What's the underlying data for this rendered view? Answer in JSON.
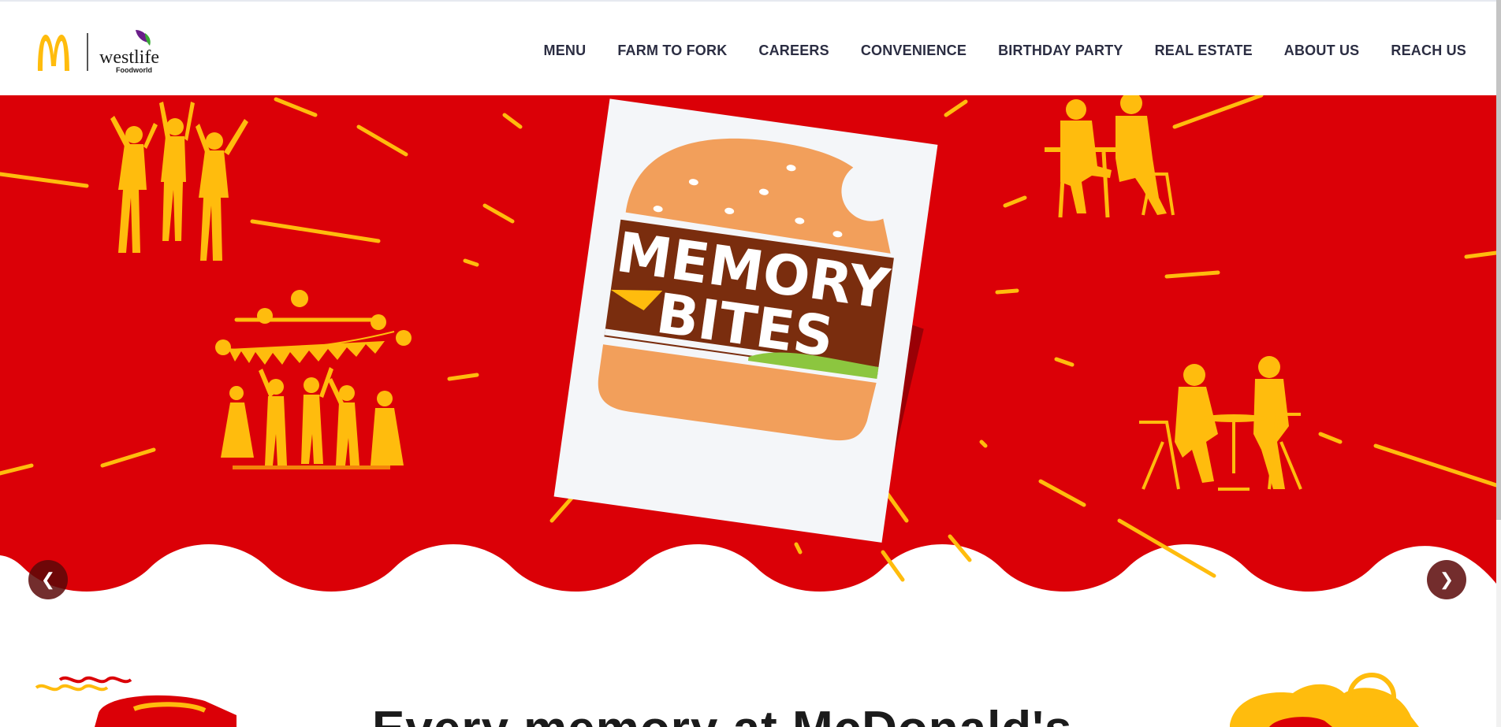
{
  "brand": {
    "logo_alt": "McDonald's | westlife Foodworld",
    "wordmark": "westlife",
    "sub_wordmark": "Foodworld",
    "colors": {
      "red": "#db0007",
      "yellow": "#ffbc0d",
      "cream": "#f29f5b",
      "brown": "#7a2d0e",
      "text": "#2b2d42"
    }
  },
  "nav": {
    "items": [
      {
        "label": "MENU"
      },
      {
        "label": "FARM TO FORK"
      },
      {
        "label": "CAREERS"
      },
      {
        "label": "CONVENIENCE"
      },
      {
        "label": "BIRTHDAY PARTY"
      },
      {
        "label": "REAL ESTATE"
      },
      {
        "label": "ABOUT US"
      },
      {
        "label": "REACH US"
      }
    ]
  },
  "hero": {
    "card_line1": "MEMORY",
    "card_line2": "BITES",
    "prev_icon": "chevron-left-icon",
    "next_icon": "chevron-right-icon"
  },
  "section": {
    "tagline": "Every memory at McDonald's"
  }
}
